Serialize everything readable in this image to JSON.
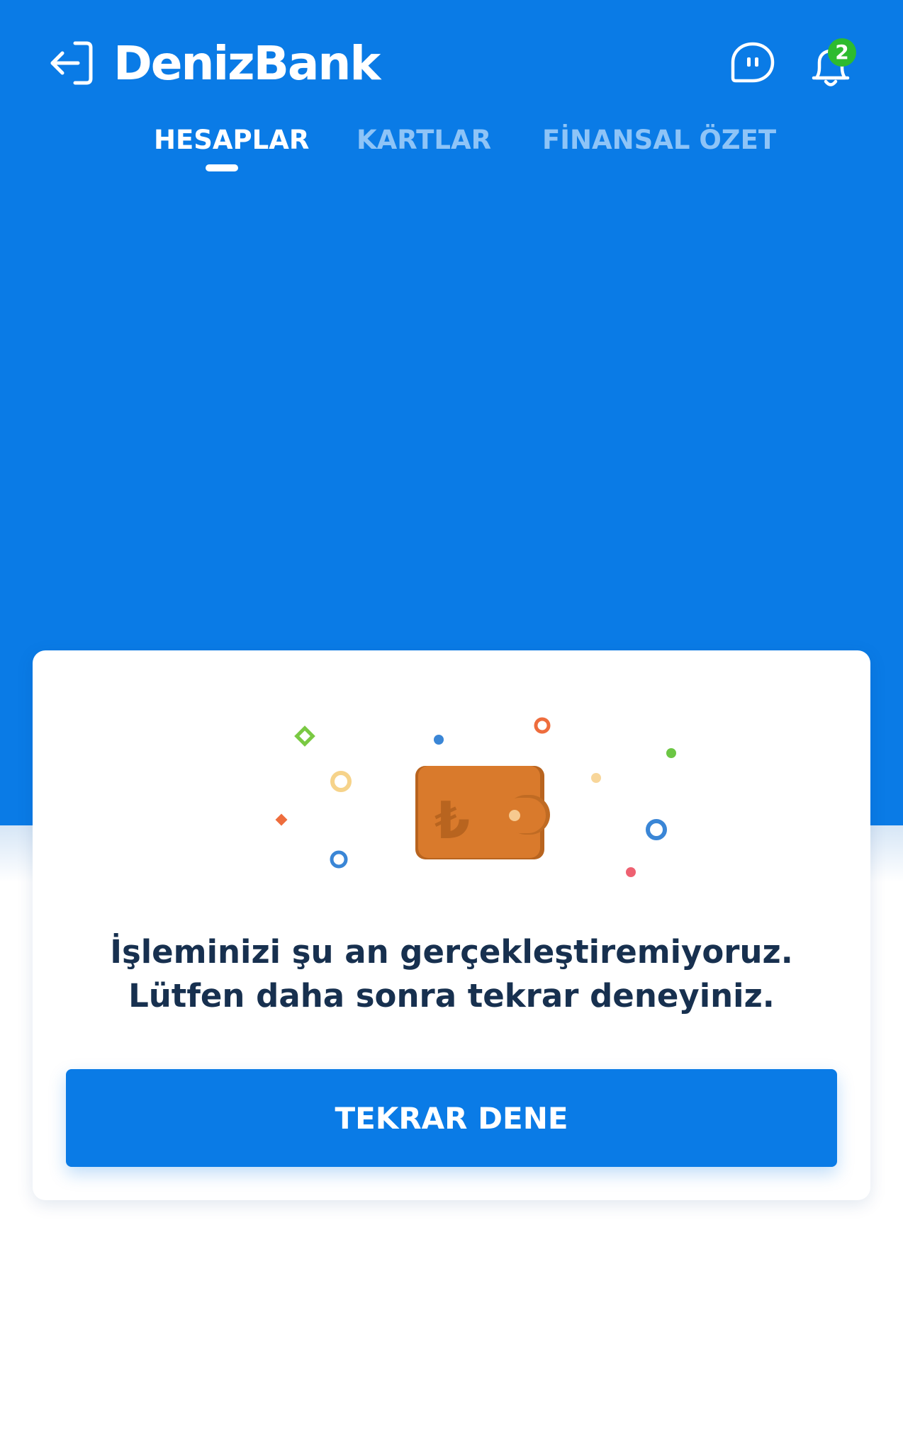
{
  "header": {
    "logo_text": "DenizBank",
    "notification_count": "2"
  },
  "tabs": [
    {
      "label": "HESAPLAR",
      "active": true
    },
    {
      "label": "KARTLAR",
      "active": false
    },
    {
      "label": "FİNANSAL ÖZET",
      "active": false
    }
  ],
  "error_card": {
    "illustration": "wallet-lira-icon",
    "message": "İşleminizi şu an gerçekleştiremiyoruz. Lütfen daha sonra tekrar deneyiniz.",
    "retry_label": "TEKRAR DENE"
  },
  "colors": {
    "brand_blue": "#0a7be6",
    "badge_green": "#2dbb2f",
    "wallet_orange": "#d97a2c",
    "text_dark": "#17304f"
  }
}
